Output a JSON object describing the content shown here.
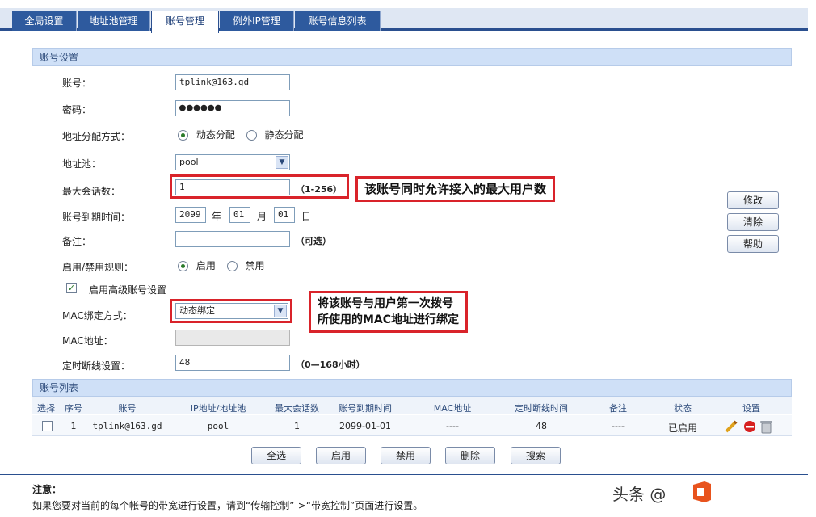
{
  "tabs": [
    {
      "label": "全局设置",
      "active": false
    },
    {
      "label": "地址池管理",
      "active": false
    },
    {
      "label": "账号管理",
      "active": true
    },
    {
      "label": "例外IP管理",
      "active": false
    },
    {
      "label": "账号信息列表",
      "active": false
    }
  ],
  "settings": {
    "title": "账号设置",
    "account_label": "账号：",
    "account_value": "tplink@163.gd",
    "password_label": "密码：",
    "password_value": "●●●●●●",
    "alloc_label": "地址分配方式：",
    "alloc_dynamic": "动态分配",
    "alloc_static": "静态分配",
    "pool_label": "地址池：",
    "pool_value": "pool",
    "max_session_label": "最大会话数：",
    "max_session_value": "1",
    "max_session_range": "（1-256）",
    "expire_label": "账号到期时间：",
    "expire_year": "2099",
    "year_unit": "年",
    "expire_month": "01",
    "month_unit": "月",
    "expire_day": "01",
    "day_unit": "日",
    "note_label": "备注：",
    "note_value": "",
    "note_hint": "（可选）",
    "rule_label": "启用/禁用规则：",
    "rule_enable": "启用",
    "rule_disable": "禁用",
    "advanced_label": "启用高级账号设置",
    "mac_bind_label": "MAC绑定方式：",
    "mac_bind_value": "动态绑定",
    "mac_addr_label": "MAC地址：",
    "mac_addr_value": "",
    "timeout_label": "定时断线设置：",
    "timeout_value": "48",
    "timeout_hint": "（0—168小时）"
  },
  "side_buttons": {
    "modify": "修改",
    "clear": "清除",
    "help": "帮助"
  },
  "callouts": {
    "max_session": "该账号同时允许接入的最大用户数",
    "mac_line1": "将该账号与用户第一次拨号",
    "mac_line2": "所使用的MAC地址进行绑定"
  },
  "list": {
    "title": "账号列表",
    "columns": [
      "选择",
      "序号",
      "账号",
      "IP地址/地址池",
      "最大会话数",
      "账号到期时间",
      "MAC地址",
      "定时断线时间",
      "备注",
      "状态",
      "设置"
    ],
    "row": {
      "index": "1",
      "account": "tplink@163.gd",
      "pool": "pool",
      "max_session": "1",
      "expire": "2099-01-01",
      "mac": "----",
      "timeout": "48",
      "note": "----",
      "status": "已启用"
    }
  },
  "bottom_buttons": {
    "select_all": "全选",
    "enable": "启用",
    "disable": "禁用",
    "delete": "删除",
    "search": "搜索"
  },
  "notice": {
    "title": "注意：",
    "text": "如果您要对当前的每个帐号的带宽进行设置，请到“传输控制”->“带宽控制”页面进行设置。"
  },
  "watermark": {
    "text": "头条 @"
  }
}
